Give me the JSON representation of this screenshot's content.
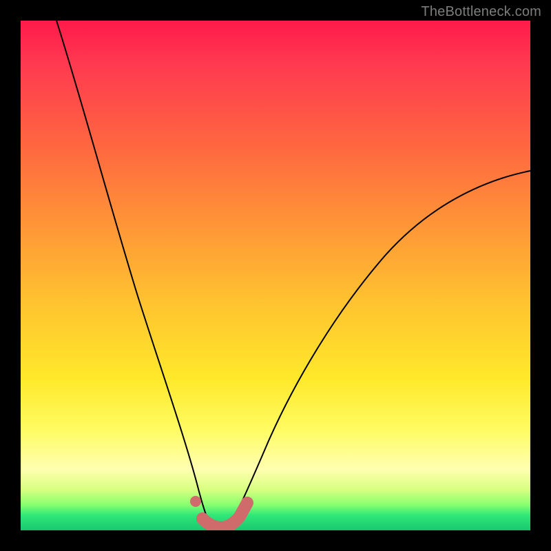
{
  "watermark": "TheBottleneck.com",
  "colors": {
    "frame_bg": "#000000",
    "gradient_top": "#ff1a4a",
    "gradient_bottom": "#18c870",
    "curve_stroke": "#000000",
    "accent_stroke": "#cf6b6b"
  },
  "chart_data": {
    "type": "line",
    "title": "",
    "xlabel": "",
    "ylabel": "",
    "xlim": [
      0,
      1
    ],
    "ylim": [
      0,
      1
    ],
    "note": "No axes, ticks, or numeric labels are visible; values are estimated as normalized coordinates (0,0 = bottom-left of colored plot area, 1,1 = top-right). The curve is a V-shape with minimum near x≈0.38, y≈0.",
    "series": [
      {
        "name": "left-branch",
        "x": [
          0.07,
          0.12,
          0.17,
          0.22,
          0.27,
          0.32,
          0.35,
          0.37
        ],
        "y": [
          1.0,
          0.82,
          0.64,
          0.46,
          0.29,
          0.13,
          0.05,
          0.01
        ]
      },
      {
        "name": "right-branch",
        "x": [
          0.41,
          0.44,
          0.5,
          0.58,
          0.68,
          0.8,
          0.92,
          1.0
        ],
        "y": [
          0.01,
          0.06,
          0.18,
          0.33,
          0.47,
          0.59,
          0.67,
          0.7
        ]
      }
    ],
    "accent": {
      "description": "Highlighted flat region at the bottom of the V, plus one isolated dot slightly up the left branch.",
      "dot": {
        "x": 0.345,
        "y": 0.055
      },
      "segment_x": [
        0.36,
        0.44
      ],
      "segment_y": [
        0.01,
        0.01
      ]
    }
  }
}
